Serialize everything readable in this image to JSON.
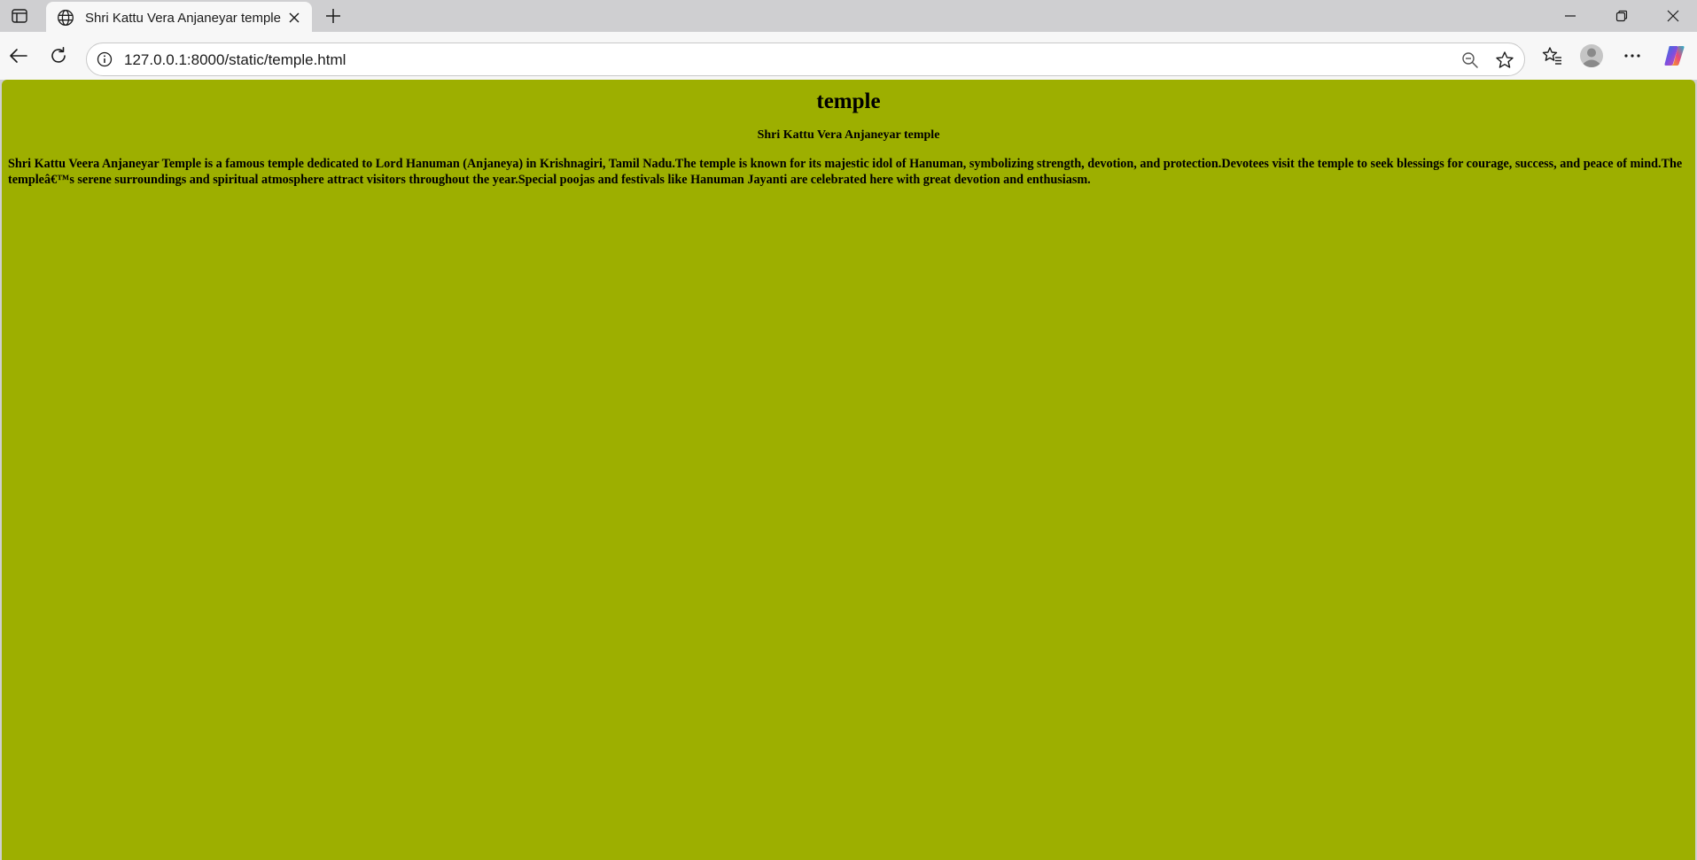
{
  "browser": {
    "tab": {
      "title": "Shri Kattu Vera Anjaneyar temple",
      "icon": "globe-icon"
    },
    "address_bar": {
      "url": "127.0.0.1:8000/static/temple.html"
    },
    "icons": {
      "tab_actions": "tab-actions-icon",
      "new_tab": "plus-icon",
      "minimize": "minimize-icon",
      "restore": "restore-icon",
      "close": "close-icon",
      "back": "back-arrow-icon",
      "reload": "reload-icon",
      "site_info": "info-icon",
      "zoom": "zoom-out-icon",
      "favorite": "star-icon",
      "favorites": "favorites-icon",
      "profile": "avatar",
      "menu": "more-icon",
      "copilot": "copilot-icon"
    }
  },
  "page": {
    "background_color": "#9daf00",
    "heading": "temple",
    "subheading": "Shri Kattu Vera Anjaneyar temple",
    "paragraph": "Shri Kattu Veera Anjaneyar Temple is a famous temple dedicated to Lord Hanuman (Anjaneya) in Krishnagiri, Tamil Nadu.The temple is known for its majestic idol of Hanuman, symbolizing strength, devotion, and protection.Devotees visit the temple to seek blessings for courage, success, and peace of mind.The templeâ€™s serene surroundings and spiritual atmosphere attract visitors throughout the year.Special poojas and festivals like Hanuman Jayanti are celebrated here with great devotion and enthusiasm."
  }
}
